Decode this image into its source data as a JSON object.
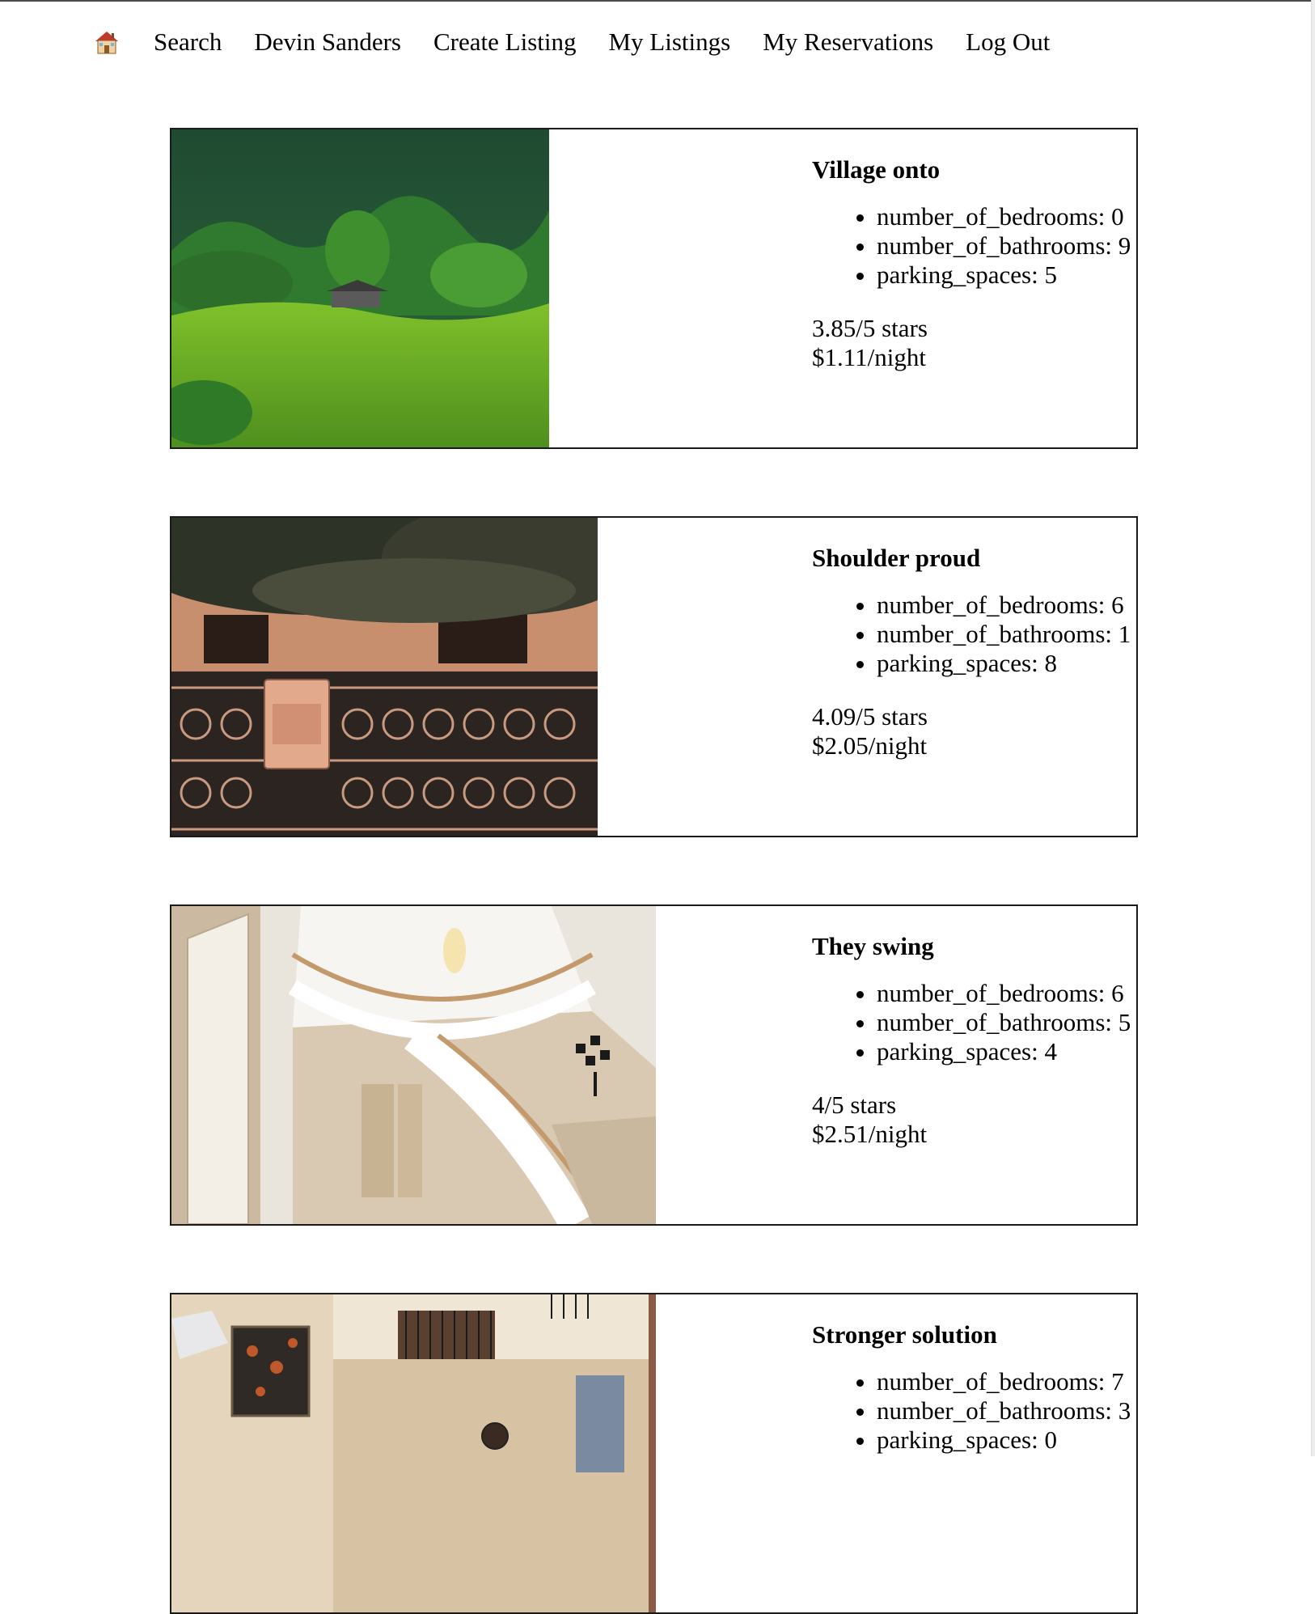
{
  "nav": {
    "home_icon": "house-emoji-icon",
    "links": [
      "Search",
      "Devin Sanders",
      "Create Listing",
      "My Listings",
      "My Reservations",
      "Log Out"
    ]
  },
  "listings": [
    {
      "title": "Village onto",
      "image": "green hillside with small cabin and forest",
      "attributes": [
        "number_of_bedrooms: 0",
        "number_of_bathrooms: 9",
        "parking_spaces: 5"
      ],
      "rating": "3.85/5 stars",
      "price": "$1.11/night"
    },
    {
      "title": "Shoulder proud",
      "image": "ornate iron fence with mailbox under tree",
      "attributes": [
        "number_of_bedrooms: 6",
        "number_of_bathrooms: 1",
        "parking_spaces: 8"
      ],
      "rating": "4.09/5 stars",
      "price": "$2.05/night"
    },
    {
      "title": "They swing",
      "image": "bright foyer with curved white staircase and chandelier",
      "attributes": [
        "number_of_bedrooms: 6",
        "number_of_bathrooms: 5",
        "parking_spaces: 4"
      ],
      "rating": "4/5 stars",
      "price": "$2.51/night"
    },
    {
      "title": "Stronger solution",
      "image": "tall living room with balcony railings and wall art",
      "attributes": [
        "number_of_bedrooms: 7",
        "number_of_bathrooms: 3",
        "parking_spaces: 0"
      ],
      "rating": "",
      "price": ""
    }
  ]
}
